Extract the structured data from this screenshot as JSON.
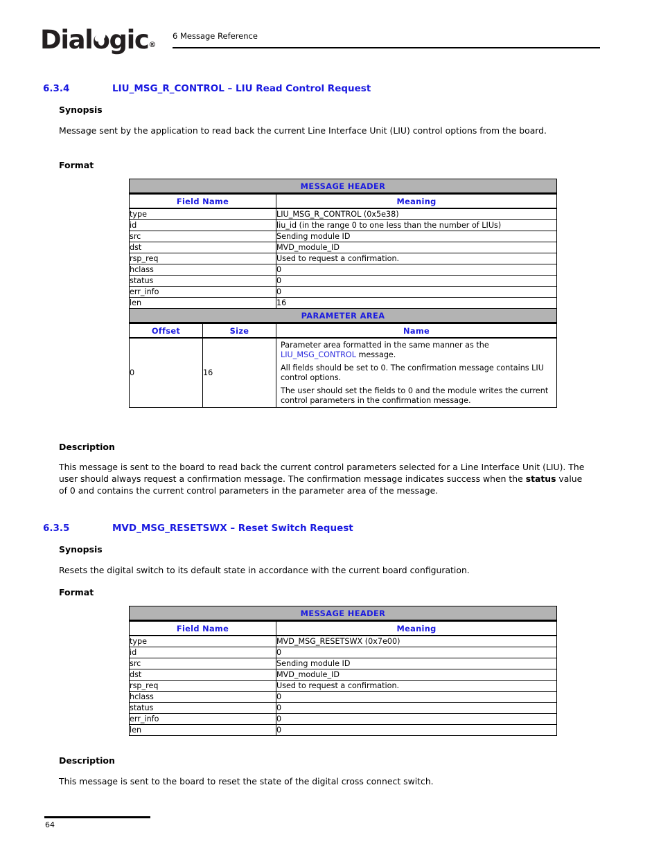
{
  "header": {
    "logo_text": "Dial",
    "logo_text_o": "o",
    "logo_text_rest": "gic",
    "logo_registered": "®",
    "running_head": "6 Message Reference"
  },
  "footer": {
    "page_number": "64"
  },
  "colors": {
    "heading_blue": "#1a1ae0",
    "table_header_blue": "#1a1ae0",
    "link_blue": "#2b2bdd",
    "band_gray": "#b3b3b3",
    "text_black": "#000000"
  },
  "sections": [
    {
      "number": "6.3.4",
      "title": "LIU_MSG_R_CONTROL – LIU Read Control Request",
      "synopsis_label": "Synopsis",
      "synopsis_text": "Message sent by the application to read back the current Line Interface Unit (LIU) control options from the board.",
      "format_label": "Format",
      "description_label": "Description",
      "description_parts": {
        "before": "This message is sent to the board to read back the current control parameters selected for a Line Interface Unit (LIU). The user should always request a confirmation message. The confirmation message indicates success when the ",
        "bold": "status",
        "after": " value of 0 and contains the current control parameters in the parameter area of the message."
      },
      "message_header": {
        "band_label": "MESSAGE HEADER",
        "columns": [
          "Field Name",
          "Meaning"
        ],
        "rows": [
          [
            "type",
            "LIU_MSG_R_CONTROL (0x5e38)"
          ],
          [
            "id",
            "liu_id (in the range 0 to one less than the number of LIUs)"
          ],
          [
            "src",
            "Sending module ID"
          ],
          [
            "dst",
            "MVD_module_ID"
          ],
          [
            "rsp_req",
            "Used to request a confirmation."
          ],
          [
            "hclass",
            "0"
          ],
          [
            "status",
            "0"
          ],
          [
            "err_info",
            "0"
          ],
          [
            "len",
            "16"
          ]
        ]
      },
      "parameter_area": {
        "band_label": "PARAMETER AREA",
        "columns": [
          "Offset",
          "Size",
          "Name"
        ],
        "rows": [
          {
            "offset": "0",
            "size": "16",
            "name_paragraphs": [
              {
                "before": "Parameter area formatted in the same manner as the ",
                "link": "LIU_MSG_CONTROL",
                "after": " message."
              },
              {
                "before": "All fields should be set to 0. The confirmation message contains LIU control options.",
                "link": "",
                "after": ""
              },
              {
                "before": "The user should set the fields to 0 and the module writes the current control parameters in the confirmation message.",
                "link": "",
                "after": ""
              }
            ]
          }
        ]
      }
    },
    {
      "number": "6.3.5",
      "title": "MVD_MSG_RESETSWX – Reset Switch Request",
      "synopsis_label": "Synopsis",
      "synopsis_text": "Resets the digital switch to its default state in accordance with the current board configuration.",
      "format_label": "Format",
      "description_label": "Description",
      "description_parts": {
        "before": "This message is sent to the board to reset the state of the digital cross connect switch.",
        "bold": "",
        "after": ""
      },
      "message_header": {
        "band_label": "MESSAGE HEADER",
        "columns": [
          "Field Name",
          "Meaning"
        ],
        "rows": [
          [
            "type",
            "MVD_MSG_RESETSWX (0x7e00)"
          ],
          [
            "id",
            "0"
          ],
          [
            "src",
            "Sending module ID"
          ],
          [
            "dst",
            "MVD_module_ID"
          ],
          [
            "rsp_req",
            "Used to request a confirmation."
          ],
          [
            "hclass",
            "0"
          ],
          [
            "status",
            "0"
          ],
          [
            "err_info",
            "0"
          ],
          [
            "len",
            "0"
          ]
        ]
      }
    }
  ]
}
